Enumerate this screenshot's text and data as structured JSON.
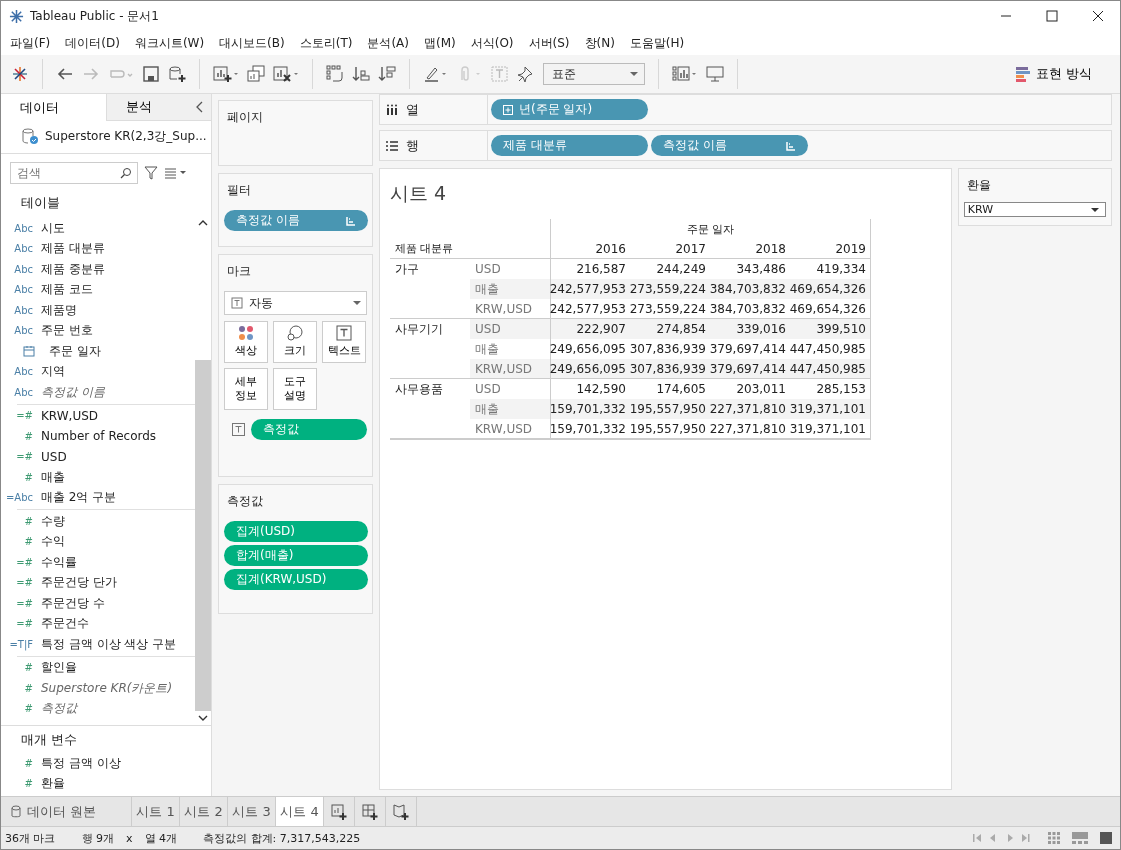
{
  "window": {
    "title": "Tableau Public - 문서1"
  },
  "menu": [
    "파일(F)",
    "데이터(D)",
    "워크시트(W)",
    "대시보드(B)",
    "스토리(T)",
    "분석(A)",
    "맵(M)",
    "서식(O)",
    "서버(S)",
    "창(N)",
    "도움말(H)"
  ],
  "toolbar": {
    "fit": "표준",
    "show_me": "표현 방식"
  },
  "data_pane": {
    "tabs": [
      {
        "label": "데이터",
        "selected": true
      },
      {
        "label": "분석",
        "selected": false
      }
    ],
    "datasource": "Superstore KR(2,3강_Sup...",
    "search": {
      "placeholder": "검색"
    },
    "section": "테이블",
    "fields": [
      {
        "icon": "Abc",
        "label": "시도",
        "kind": "dimension",
        "generated": false
      },
      {
        "icon": "Abc",
        "label": "제품 대분류",
        "kind": "dimension",
        "generated": false
      },
      {
        "icon": "Abc",
        "label": "제품 중분류",
        "kind": "dimension",
        "generated": false
      },
      {
        "icon": "Abc",
        "label": "제품 코드",
        "kind": "dimension",
        "generated": false
      },
      {
        "icon": "Abc",
        "label": "제품명",
        "kind": "dimension",
        "generated": false
      },
      {
        "icon": "Abc",
        "label": "주문 번호",
        "kind": "dimension",
        "generated": false
      },
      {
        "label": "주문 일자",
        "kind": "date",
        "generated": false
      },
      {
        "icon": "Abc",
        "label": "지역",
        "kind": "dimension",
        "generated": false
      },
      {
        "icon": "Abc",
        "label": "측정값 이름",
        "kind": "dimension",
        "generated": true
      },
      {
        "icon": "=#",
        "label": "KRW,USD",
        "kind": "measure",
        "generated": false
      },
      {
        "icon": "#",
        "label": "Number of Records",
        "kind": "measure",
        "generated": false
      },
      {
        "icon": "=#",
        "label": "USD",
        "kind": "measure",
        "generated": false
      },
      {
        "icon": "#",
        "label": "매출",
        "kind": "measure",
        "generated": false
      },
      {
        "icon": "=Abc",
        "label": "매출 2억 구분",
        "kind": "dimension",
        "generated": false
      },
      {
        "icon": "#",
        "label": "수량",
        "kind": "measure",
        "generated": false
      },
      {
        "icon": "#",
        "label": "수익",
        "kind": "measure",
        "generated": false
      },
      {
        "icon": "=#",
        "label": "수익률",
        "kind": "measure",
        "generated": false
      },
      {
        "icon": "=#",
        "label": "주문건당 단가",
        "kind": "measure",
        "generated": false
      },
      {
        "icon": "=#",
        "label": "주문건당 수",
        "kind": "measure",
        "generated": false
      },
      {
        "icon": "=#",
        "label": "주문건수",
        "kind": "measure",
        "generated": false
      },
      {
        "icon": "=T|F",
        "label": "특정 금액 이상 색상 구분",
        "kind": "dimension",
        "generated": false
      },
      {
        "icon": "#",
        "label": "할인율",
        "kind": "measure",
        "generated": false
      },
      {
        "icon": "#",
        "label": "Superstore KR(카운트)",
        "kind": "measure",
        "generated": true
      },
      {
        "icon": "#",
        "label": "측정값",
        "kind": "measure",
        "generated": true
      }
    ],
    "parameters": {
      "title": "매개 변수",
      "items": [
        {
          "icon": "#",
          "label": "특정 금액 이상"
        },
        {
          "icon": "#",
          "label": "환율"
        }
      ]
    }
  },
  "cards": {
    "pages": {
      "title": "페이지"
    },
    "filters": {
      "title": "필터",
      "pills": [
        {
          "label": "측정값 이름",
          "kind": "dimension",
          "sorted": true,
          "hierarchy": false
        }
      ]
    },
    "marks": {
      "title": "마크",
      "type": "자동",
      "buttons": [
        {
          "label": "색상",
          "kind": "color"
        },
        {
          "label": "크기",
          "kind": "size"
        },
        {
          "label": "텍스트",
          "kind": "text"
        },
        {
          "label": "세부\n정보",
          "kind": "detail"
        },
        {
          "label": "도구\n설명",
          "kind": "tooltip"
        }
      ],
      "pills": [
        {
          "label": "측정값",
          "kind": "measure",
          "sorted": false,
          "hierarchy": false
        }
      ]
    },
    "measure_values": {
      "title": "측정값",
      "pills": [
        {
          "label": "집계(USD)",
          "kind": "measure",
          "sorted": false,
          "hierarchy": false
        },
        {
          "label": "합계(매출)",
          "kind": "measure",
          "sorted": false,
          "hierarchy": false
        },
        {
          "label": "집계(KRW,USD)",
          "kind": "measure",
          "sorted": false,
          "hierarchy": false
        }
      ]
    }
  },
  "shelves": [
    {
      "label": "열",
      "kind": "columns",
      "pills": [
        {
          "label": "년(주문 일자)",
          "kind": "dimension",
          "sorted": false,
          "hierarchy": true
        }
      ]
    },
    {
      "label": "행",
      "kind": "rows",
      "pills": [
        {
          "label": "제품 대분류",
          "kind": "dimension",
          "sorted": false,
          "hierarchy": false
        },
        {
          "label": "측정값 이름",
          "kind": "dimension",
          "sorted": true,
          "hierarchy": false
        }
      ]
    }
  ],
  "view": {
    "title": "시트 4",
    "column_header": "주문 일자",
    "row_header": "제품 대분류",
    "years": [
      "2016",
      "2017",
      "2018",
      "2019"
    ],
    "groups": [
      {
        "label": "가구",
        "rows": [
          {
            "measure": "USD",
            "values": [
              "216,587",
              "244,249",
              "343,486",
              "419,334"
            ]
          },
          {
            "measure": "매출",
            "values": [
              "242,577,953",
              "273,559,224",
              "384,703,832",
              "469,654,326"
            ]
          },
          {
            "measure": "KRW,USD",
            "values": [
              "242,577,953",
              "273,559,224",
              "384,703,832",
              "469,654,326"
            ]
          }
        ]
      },
      {
        "label": "사무기기",
        "rows": [
          {
            "measure": "USD",
            "values": [
              "222,907",
              "274,854",
              "339,016",
              "399,510"
            ]
          },
          {
            "measure": "매출",
            "values": [
              "249,656,095",
              "307,836,939",
              "379,697,414",
              "447,450,985"
            ]
          },
          {
            "measure": "KRW,USD",
            "values": [
              "249,656,095",
              "307,836,939",
              "379,697,414",
              "447,450,985"
            ]
          }
        ]
      },
      {
        "label": "사무용품",
        "rows": [
          {
            "measure": "USD",
            "values": [
              "142,590",
              "174,605",
              "203,011",
              "285,153"
            ]
          },
          {
            "measure": "매출",
            "values": [
              "159,701,332",
              "195,557,950",
              "227,371,810",
              "319,371,101"
            ]
          },
          {
            "measure": "KRW,USD",
            "values": [
              "159,701,332",
              "195,557,950",
              "227,371,810",
              "319,371,101"
            ]
          }
        ]
      }
    ]
  },
  "parameter_control": {
    "title": "환율",
    "value": "KRW"
  },
  "sheet_tabs": {
    "data_source": "데이터 원본",
    "sheets": [
      {
        "label": "시트 1",
        "selected": false
      },
      {
        "label": "시트 2",
        "selected": false
      },
      {
        "label": "시트 3",
        "selected": false
      },
      {
        "label": "시트 4",
        "selected": true
      }
    ]
  },
  "status_bar": {
    "marks": "36개 마크",
    "rows": "행 9개",
    "times": "x",
    "columns": "열 4개",
    "sum": "측정값의 합계: 7,317,543,225"
  }
}
